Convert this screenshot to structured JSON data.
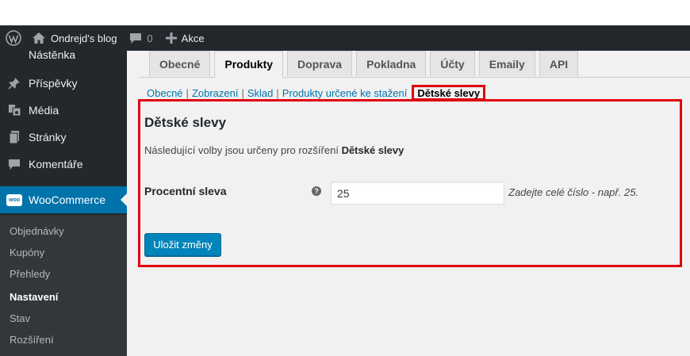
{
  "admin_bar": {
    "site_name": "Ondrejd's blog",
    "comments_count": "0",
    "new_label": "Akce"
  },
  "sidebar": {
    "cut_item": "Nástěnka",
    "items": [
      {
        "label": "Příspěvky",
        "icon": "pin-icon"
      },
      {
        "label": "Média",
        "icon": "media-icon"
      },
      {
        "label": "Stránky",
        "icon": "pages-icon"
      },
      {
        "label": "Komentáře",
        "icon": "comment-icon"
      }
    ],
    "woocommerce": {
      "label": "WooCommerce",
      "icon_text": "woo"
    },
    "submenu": [
      "Objednávky",
      "Kupóny",
      "Přehledy",
      "Nastavení",
      "Stav",
      "Rozšíření"
    ],
    "current_submenu": "Nastavení"
  },
  "tabs": [
    "Obecné",
    "Produkty",
    "Doprava",
    "Pokladna",
    "Účty",
    "Emaily",
    "API"
  ],
  "active_tab": "Produkty",
  "subsections": [
    "Obecné",
    "Zobrazení",
    "Sklad",
    "Produkty určené ke stažení"
  ],
  "subsection_separator": "|",
  "current_subsection": "Dětské slevy",
  "section": {
    "title": "Dětské slevy",
    "description_prefix": "Následující volby jsou určeny pro rozšíření ",
    "description_bold": "Dětské slevy"
  },
  "field": {
    "label": "Procentní sleva",
    "help_icon": "?",
    "value": "25",
    "hint": "Zadejte celé číslo - např. 25."
  },
  "save_button": "Uložit změny",
  "colors": {
    "adminbar_bg": "#23282d",
    "accent_blue": "#0073aa",
    "highlight_red": "#e0000f",
    "button_blue": "#0085ba"
  }
}
